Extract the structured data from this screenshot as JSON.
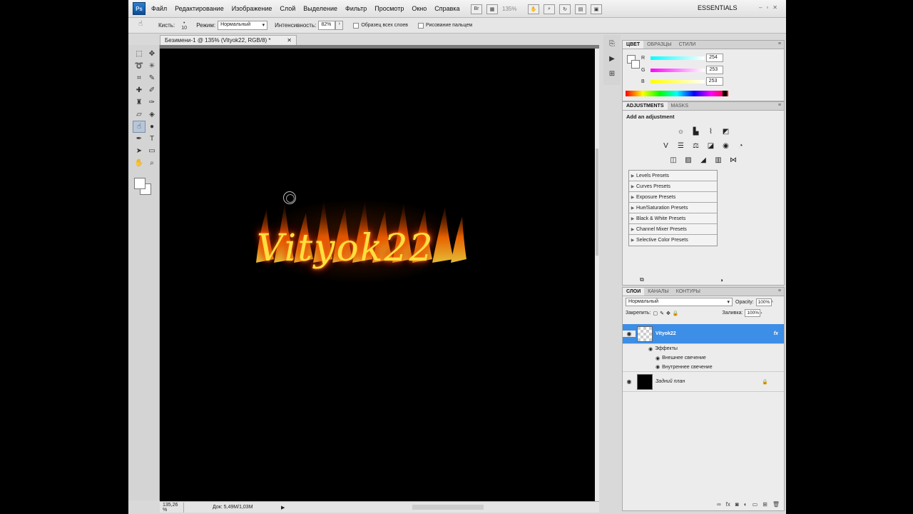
{
  "menubar": {
    "logo": "Ps",
    "items": [
      "Файл",
      "Редактирование",
      "Изображение",
      "Слой",
      "Выделение",
      "Фильтр",
      "Просмотр",
      "Окно",
      "Справка"
    ],
    "zoom": "135%",
    "workspace": "ESSENTIALS"
  },
  "options": {
    "brush_label": "Кисть:",
    "brush_size": "10",
    "mode_label": "Режим:",
    "mode_value": "Нормальный",
    "intensity_label": "Интенсивность:",
    "intensity_value": "82%",
    "sample_all": "Образец всех слоев",
    "finger_paint": "Рисование пальцем"
  },
  "document": {
    "tab_title": "Безимени-1 @ 135% (Vityok22, RGB/8) *",
    "canvas_text": "Vityok22",
    "zoom": "135,26 %",
    "doc_size": "Док: 5,49M/1,03M"
  },
  "color_panel": {
    "tabs": [
      "ЦВЕТ",
      "ОБРАЗЦЫ",
      "СТИЛИ"
    ],
    "r": {
      "label": "R",
      "value": "254"
    },
    "g": {
      "label": "G",
      "value": "253"
    },
    "b": {
      "label": "B",
      "value": "253"
    }
  },
  "adjustments_panel": {
    "tabs": [
      "ADJUSTMENTS",
      "MASKS"
    ],
    "title": "Add an adjustment",
    "presets": [
      "Levels Presets",
      "Curves Presets",
      "Exposure Presets",
      "Hue/Saturation Presets",
      "Black & White Presets",
      "Channel Mixer Presets",
      "Selective Color Presets"
    ]
  },
  "layers_panel": {
    "tabs": [
      "СЛОИ",
      "КАНАЛЫ",
      "КОНТУРЫ"
    ],
    "blend_mode": "Нормальный",
    "opacity_label": "Opacity:",
    "opacity_value": "100%",
    "lock_label": "Закрепить:",
    "fill_label": "Заливка:",
    "fill_value": "100%",
    "layers": [
      {
        "name": "Vityok22",
        "fx": "fx"
      },
      {
        "name": "Задний план"
      }
    ],
    "effects_label": "Эффекты",
    "effects": [
      "Внешнее свечение",
      "Внутреннее свечение"
    ]
  }
}
